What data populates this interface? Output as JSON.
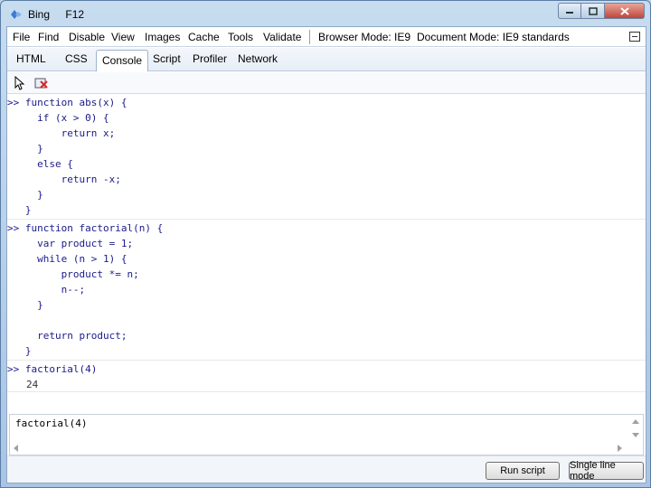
{
  "window": {
    "app_name": "Bing",
    "tool_name": "F12"
  },
  "menu": {
    "items": [
      "File",
      "Find",
      "Disable",
      "View",
      "Images",
      "Cache",
      "Tools",
      "Validate"
    ],
    "browser_mode_label": "Browser Mode:",
    "browser_mode_value": "IE9",
    "document_mode_label": "Document Mode:",
    "document_mode_value": "IE9 standards"
  },
  "tabs": [
    "HTML",
    "CSS",
    "Console",
    "Script",
    "Profiler",
    "Network"
  ],
  "active_tab": "Console",
  "console": {
    "entries": [
      {
        "lines": [
          ">> function abs(x) {",
          "     if (x > 0) {",
          "         return x;",
          "     }",
          "     else {",
          "         return -x;",
          "     }",
          "   }"
        ]
      },
      {
        "lines": [
          ">> function factorial(n) {",
          "     var product = 1;",
          "     while (n > 1) {",
          "         product *= n;",
          "         n--;",
          "     }",
          "",
          "     return product;",
          "   }"
        ]
      },
      {
        "lines": [
          ">> factorial(4)"
        ],
        "result": "24"
      }
    ]
  },
  "input": {
    "value": "factorial(4)"
  },
  "buttons": {
    "run_script": "Run script",
    "single_line_mode": "Single line mode"
  }
}
